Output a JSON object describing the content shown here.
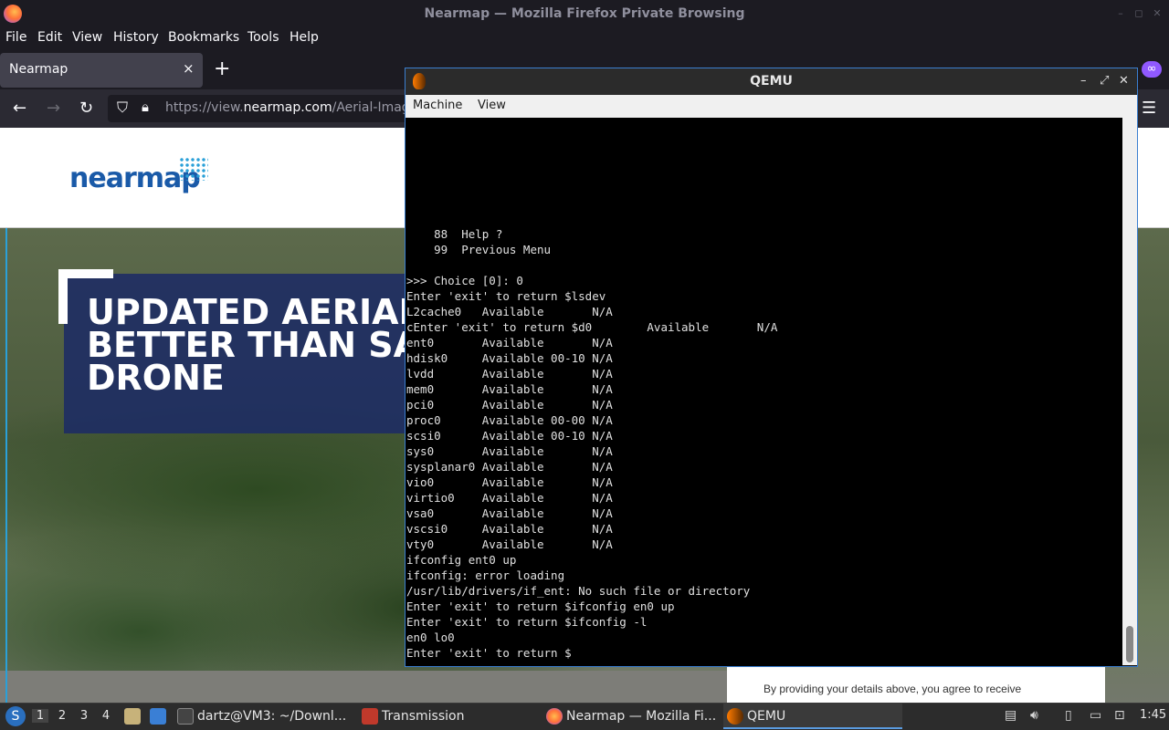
{
  "firefox": {
    "window_title": "Nearmap — Mozilla Firefox Private Browsing",
    "menu": [
      "File",
      "Edit",
      "View",
      "History",
      "Bookmarks",
      "Tools",
      "Help"
    ],
    "tab_title": "Nearmap",
    "new_tab_symbol": "+",
    "tab_close_symbol": "×",
    "url_prefix": "https://view.",
    "url_domain": "nearmap.com",
    "url_suffix": "/Aerial-Imagery"
  },
  "page": {
    "logo_text": "nearmap",
    "hero_title": "UPDATED AERIAL I\nBETTER THAN SAT\nDRONE",
    "consent_text": "By providing your details above, you agree to receive"
  },
  "qemu": {
    "title": "QEMU",
    "menu": [
      "Machine",
      "View"
    ],
    "terminal_lines": [
      "    88  Help ?",
      "    99  Previous Menu",
      "",
      ">>> Choice [0]: 0",
      "Enter 'exit' to return $lsdev",
      "L2cache0   Available       N/A",
      "cEnter 'exit' to return $d0        Available       N/A",
      "ent0       Available       N/A",
      "hdisk0     Available 00-10 N/A",
      "lvdd       Available       N/A",
      "mem0       Available       N/A",
      "pci0       Available       N/A",
      "proc0      Available 00-00 N/A",
      "scsi0      Available 00-10 N/A",
      "sys0       Available       N/A",
      "sysplanar0 Available       N/A",
      "vio0       Available       N/A",
      "virtio0    Available       N/A",
      "vsa0       Available       N/A",
      "vscsi0     Available       N/A",
      "vty0       Available       N/A",
      "ifconfig ent0 up",
      "ifconfig: error loading",
      "/usr/lib/drivers/if_ent: No such file or directory",
      "Enter 'exit' to return $ifconfig en0 up",
      "Enter 'exit' to return $ifconfig -l",
      "en0 lo0",
      "Enter 'exit' to return $"
    ]
  },
  "taskbar": {
    "workspaces": [
      "1",
      "2",
      "3",
      "4"
    ],
    "tasks": [
      {
        "label": "dartz@VM3: ~/Downl..."
      },
      {
        "label": "Transmission"
      },
      {
        "label": "Nearmap — Mozilla Fi..."
      },
      {
        "label": "QEMU"
      }
    ],
    "clock": "1:45"
  }
}
